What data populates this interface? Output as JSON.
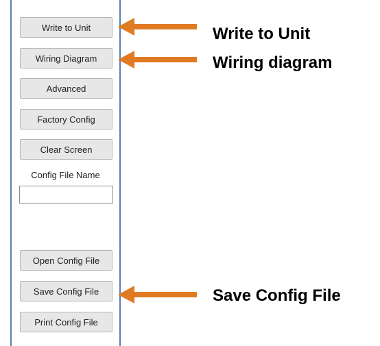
{
  "panel": {
    "buttons": {
      "write_to_unit": "Write to Unit",
      "wiring_diagram": "Wiring Diagram",
      "advanced": "Advanced",
      "factory_config": "Factory Config",
      "clear_screen": "Clear Screen",
      "open_config_file": "Open Config File",
      "save_config_file": "Save Config File",
      "print_config_file": "Print Config File"
    },
    "config_file_name": {
      "label": "Config File Name",
      "value": ""
    }
  },
  "callouts": {
    "write_to_unit": "Write to Unit",
    "wiring_diagram": "Wiring diagram",
    "save_config_file": "Save Config File"
  },
  "colors": {
    "arrow": "#E07B24",
    "panel_border": "#5A7FB0",
    "button_face": "#E7E7E7"
  }
}
